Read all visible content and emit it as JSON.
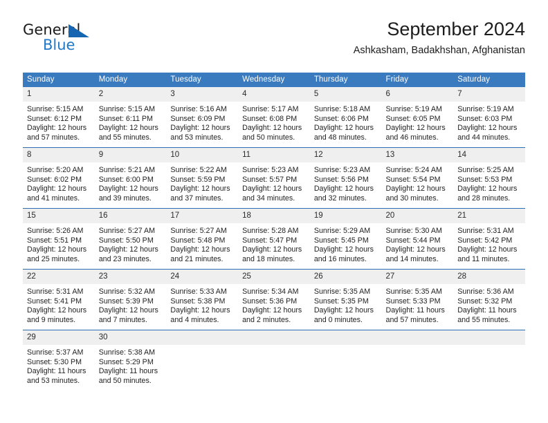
{
  "brand": {
    "line1": "General",
    "line2": "Blue",
    "triangle_icon": "brand-triangle-icon",
    "colors": {
      "triangle": "#1565b0",
      "blue_text": "#2079c9",
      "dark_text": "#1a1a1a"
    }
  },
  "header": {
    "title": "September 2024",
    "subtitle": "Ashkasham, Badakhshan, Afghanistan"
  },
  "calendar": {
    "accent_color": "#3a7bbf",
    "row_divider_color": "#2a6db5",
    "daynum_bg": "#efefef",
    "weekday_headers": [
      "Sunday",
      "Monday",
      "Tuesday",
      "Wednesday",
      "Thursday",
      "Friday",
      "Saturday"
    ],
    "weeks": [
      [
        {
          "day": "1",
          "sunrise": "Sunrise: 5:15 AM",
          "sunset": "Sunset: 6:12 PM",
          "daylight": "Daylight: 12 hours and 57 minutes."
        },
        {
          "day": "2",
          "sunrise": "Sunrise: 5:15 AM",
          "sunset": "Sunset: 6:11 PM",
          "daylight": "Daylight: 12 hours and 55 minutes."
        },
        {
          "day": "3",
          "sunrise": "Sunrise: 5:16 AM",
          "sunset": "Sunset: 6:09 PM",
          "daylight": "Daylight: 12 hours and 53 minutes."
        },
        {
          "day": "4",
          "sunrise": "Sunrise: 5:17 AM",
          "sunset": "Sunset: 6:08 PM",
          "daylight": "Daylight: 12 hours and 50 minutes."
        },
        {
          "day": "5",
          "sunrise": "Sunrise: 5:18 AM",
          "sunset": "Sunset: 6:06 PM",
          "daylight": "Daylight: 12 hours and 48 minutes."
        },
        {
          "day": "6",
          "sunrise": "Sunrise: 5:19 AM",
          "sunset": "Sunset: 6:05 PM",
          "daylight": "Daylight: 12 hours and 46 minutes."
        },
        {
          "day": "7",
          "sunrise": "Sunrise: 5:19 AM",
          "sunset": "Sunset: 6:03 PM",
          "daylight": "Daylight: 12 hours and 44 minutes."
        }
      ],
      [
        {
          "day": "8",
          "sunrise": "Sunrise: 5:20 AM",
          "sunset": "Sunset: 6:02 PM",
          "daylight": "Daylight: 12 hours and 41 minutes."
        },
        {
          "day": "9",
          "sunrise": "Sunrise: 5:21 AM",
          "sunset": "Sunset: 6:00 PM",
          "daylight": "Daylight: 12 hours and 39 minutes."
        },
        {
          "day": "10",
          "sunrise": "Sunrise: 5:22 AM",
          "sunset": "Sunset: 5:59 PM",
          "daylight": "Daylight: 12 hours and 37 minutes."
        },
        {
          "day": "11",
          "sunrise": "Sunrise: 5:23 AM",
          "sunset": "Sunset: 5:57 PM",
          "daylight": "Daylight: 12 hours and 34 minutes."
        },
        {
          "day": "12",
          "sunrise": "Sunrise: 5:23 AM",
          "sunset": "Sunset: 5:56 PM",
          "daylight": "Daylight: 12 hours and 32 minutes."
        },
        {
          "day": "13",
          "sunrise": "Sunrise: 5:24 AM",
          "sunset": "Sunset: 5:54 PM",
          "daylight": "Daylight: 12 hours and 30 minutes."
        },
        {
          "day": "14",
          "sunrise": "Sunrise: 5:25 AM",
          "sunset": "Sunset: 5:53 PM",
          "daylight": "Daylight: 12 hours and 28 minutes."
        }
      ],
      [
        {
          "day": "15",
          "sunrise": "Sunrise: 5:26 AM",
          "sunset": "Sunset: 5:51 PM",
          "daylight": "Daylight: 12 hours and 25 minutes."
        },
        {
          "day": "16",
          "sunrise": "Sunrise: 5:27 AM",
          "sunset": "Sunset: 5:50 PM",
          "daylight": "Daylight: 12 hours and 23 minutes."
        },
        {
          "day": "17",
          "sunrise": "Sunrise: 5:27 AM",
          "sunset": "Sunset: 5:48 PM",
          "daylight": "Daylight: 12 hours and 21 minutes."
        },
        {
          "day": "18",
          "sunrise": "Sunrise: 5:28 AM",
          "sunset": "Sunset: 5:47 PM",
          "daylight": "Daylight: 12 hours and 18 minutes."
        },
        {
          "day": "19",
          "sunrise": "Sunrise: 5:29 AM",
          "sunset": "Sunset: 5:45 PM",
          "daylight": "Daylight: 12 hours and 16 minutes."
        },
        {
          "day": "20",
          "sunrise": "Sunrise: 5:30 AM",
          "sunset": "Sunset: 5:44 PM",
          "daylight": "Daylight: 12 hours and 14 minutes."
        },
        {
          "day": "21",
          "sunrise": "Sunrise: 5:31 AM",
          "sunset": "Sunset: 5:42 PM",
          "daylight": "Daylight: 12 hours and 11 minutes."
        }
      ],
      [
        {
          "day": "22",
          "sunrise": "Sunrise: 5:31 AM",
          "sunset": "Sunset: 5:41 PM",
          "daylight": "Daylight: 12 hours and 9 minutes."
        },
        {
          "day": "23",
          "sunrise": "Sunrise: 5:32 AM",
          "sunset": "Sunset: 5:39 PM",
          "daylight": "Daylight: 12 hours and 7 minutes."
        },
        {
          "day": "24",
          "sunrise": "Sunrise: 5:33 AM",
          "sunset": "Sunset: 5:38 PM",
          "daylight": "Daylight: 12 hours and 4 minutes."
        },
        {
          "day": "25",
          "sunrise": "Sunrise: 5:34 AM",
          "sunset": "Sunset: 5:36 PM",
          "daylight": "Daylight: 12 hours and 2 minutes."
        },
        {
          "day": "26",
          "sunrise": "Sunrise: 5:35 AM",
          "sunset": "Sunset: 5:35 PM",
          "daylight": "Daylight: 12 hours and 0 minutes."
        },
        {
          "day": "27",
          "sunrise": "Sunrise: 5:35 AM",
          "sunset": "Sunset: 5:33 PM",
          "daylight": "Daylight: 11 hours and 57 minutes."
        },
        {
          "day": "28",
          "sunrise": "Sunrise: 5:36 AM",
          "sunset": "Sunset: 5:32 PM",
          "daylight": "Daylight: 11 hours and 55 minutes."
        }
      ],
      [
        {
          "day": "29",
          "sunrise": "Sunrise: 5:37 AM",
          "sunset": "Sunset: 5:30 PM",
          "daylight": "Daylight: 11 hours and 53 minutes."
        },
        {
          "day": "30",
          "sunrise": "Sunrise: 5:38 AM",
          "sunset": "Sunset: 5:29 PM",
          "daylight": "Daylight: 11 hours and 50 minutes."
        },
        {
          "day": "",
          "sunrise": "",
          "sunset": "",
          "daylight": ""
        },
        {
          "day": "",
          "sunrise": "",
          "sunset": "",
          "daylight": ""
        },
        {
          "day": "",
          "sunrise": "",
          "sunset": "",
          "daylight": ""
        },
        {
          "day": "",
          "sunrise": "",
          "sunset": "",
          "daylight": ""
        },
        {
          "day": "",
          "sunrise": "",
          "sunset": "",
          "daylight": ""
        }
      ]
    ]
  }
}
